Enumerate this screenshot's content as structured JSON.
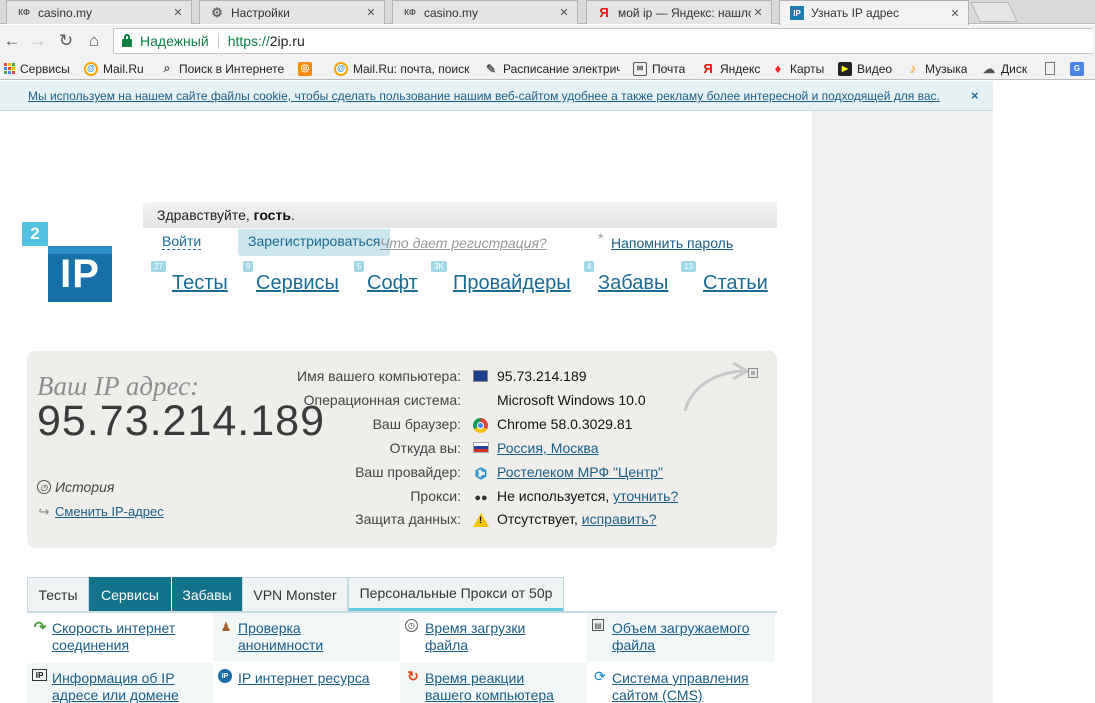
{
  "browser": {
    "tabs": [
      {
        "icon": "casino-favicon",
        "icon_text": "КФ",
        "title": "casino.my"
      },
      {
        "icon": "gear-icon",
        "icon_text": "⚙",
        "title": "Настройки"
      },
      {
        "icon": "casino-favicon",
        "icon_text": "КФ",
        "title": "casino.my"
      },
      {
        "icon": "yandex-icon",
        "icon_text": "Я",
        "title": "мой ip — Яндекс: нашлось"
      },
      {
        "icon": "2ip-favicon",
        "icon_text": "IP",
        "title": "Узнать IP адрес",
        "active": true
      }
    ],
    "tab_close": "✕",
    "address": {
      "secure_label": "Надежный",
      "scheme": "https://",
      "host": "2ip.ru"
    },
    "nav": {
      "back": "←",
      "forward": "→",
      "reload": "↻",
      "home": "⌂"
    },
    "bookmarks": [
      {
        "icon": "apps-icon",
        "label": "Сервисы"
      },
      {
        "icon": "mailru-icon",
        "icon_text": "@",
        "label": "Mail.Ru"
      },
      {
        "icon": "search-icon",
        "icon_text": "🔍",
        "label": "Поиск в Интернете"
      },
      {
        "icon": "odnoklassniki-icon",
        "icon_text": "ок",
        "label": ""
      },
      {
        "icon": "mailru-icon",
        "icon_text": "@",
        "label": "Mail.Ru: почта, поиск"
      },
      {
        "icon": "schedule-icon",
        "icon_text": "✎",
        "label": "Расписание электрич"
      },
      {
        "icon": "mail-envelope-icon",
        "icon_text": "✉",
        "label": "Почта"
      },
      {
        "icon": "yandex-icon",
        "icon_text": "Я",
        "label": "Яндекс"
      },
      {
        "icon": "maps-pin-icon",
        "icon_text": "♦",
        "label": "Карты"
      },
      {
        "icon": "video-icon",
        "icon_text": "▶",
        "label": "Видео"
      },
      {
        "icon": "music-icon",
        "icon_text": "♪",
        "label": "Музыка"
      },
      {
        "icon": "disk-icon",
        "icon_text": "☁",
        "label": "Диск"
      },
      {
        "icon": "document-icon",
        "icon_text": "",
        "label": ""
      },
      {
        "icon": "google-translate-icon",
        "icon_text": "G",
        "label": ""
      }
    ]
  },
  "cookie_bar": {
    "text": "Мы используем на нашем сайте файлы cookie, чтобы сделать пользование нашим веб-сайтом удобнее а также рекламу более интересной и подходящей для вас.",
    "close": "×"
  },
  "header": {
    "logo_badge": "2",
    "logo_text": "IP",
    "greeting_prefix": "Здравствуйте, ",
    "greeting_user": "гость",
    "greeting_suffix": ".",
    "login": "Войти",
    "register": "Зарегистрироваться",
    "why_register": "Что дает регистрация?",
    "remind_star": "*",
    "remind_password": "Напомнить пароль",
    "menu": [
      {
        "label": "Тесты",
        "badge": "27"
      },
      {
        "label": "Сервисы",
        "badge": "9"
      },
      {
        "label": "Софт",
        "badge": "5"
      },
      {
        "label": "Провайдеры",
        "badge": "3K"
      },
      {
        "label": "Забавы",
        "badge": "4"
      },
      {
        "label": "Статьи",
        "badge": "13"
      }
    ]
  },
  "ip_box": {
    "label": "Ваш IP адрес:",
    "ip": "95.73.214.189",
    "history": "История",
    "change_ip": "Сменить IP-адрес",
    "rows": [
      {
        "key": "Имя вашего компьютера:",
        "icon": "monitor-icon",
        "value": "95.73.214.189"
      },
      {
        "key": "Операционная система:",
        "icon": "windows-icon",
        "value": "Microsoft Windows 10.0"
      },
      {
        "key": "Ваш браузер:",
        "icon": "chrome-icon",
        "value": "Chrome 58.0.3029.81"
      },
      {
        "key": "Откуда вы:",
        "icon": "russia-flag-icon",
        "link": "Россия, Москва"
      },
      {
        "key": "Ваш провайдер:",
        "icon": "rostelecom-icon",
        "link": "Ростелеком МРФ \"Центр\""
      },
      {
        "key": "Прокси:",
        "icon": "glasses-icon",
        "value": "Не используется, ",
        "link": "уточнить?"
      },
      {
        "key": "Защита данных:",
        "icon": "warning-icon",
        "value": "Отсутствует, ",
        "link": "исправить?"
      }
    ]
  },
  "bottom_tabs": [
    {
      "label": "Тесты",
      "active": false
    },
    {
      "label": "Сервисы",
      "active": true
    },
    {
      "label": "Забавы",
      "active": true
    },
    {
      "label": "VPN Monster",
      "active": false
    },
    {
      "label": "Персональные Прокси от 50р",
      "active": false
    }
  ],
  "services": [
    {
      "icon": "speed-icon",
      "line1": "Скорость интернет",
      "line2": "соединения"
    },
    {
      "icon": "anonymity-icon",
      "line1": "Проверка",
      "line2": "анонимности"
    },
    {
      "icon": "clock-icon",
      "line1": "Время загрузки",
      "line2": "файла"
    },
    {
      "icon": "file-size-icon",
      "line1": "Объем загружаемого",
      "line2": "файла"
    },
    {
      "icon": "ip-info-icon",
      "line1": "Информация об IP",
      "line2": "адресе или домене"
    },
    {
      "icon": "ip-resource-icon",
      "line1": "IP интернет ресурса",
      "line2": ""
    },
    {
      "icon": "reaction-icon",
      "line1": "Время реакции",
      "line2": "вашего компьютера"
    },
    {
      "icon": "cms-icon",
      "line1": "Система управления",
      "line2": "сайтом (CMS)"
    }
  ],
  "colors": {
    "brand": "#1870a8",
    "accent": "#52c1e2",
    "link": "#1a5e86",
    "active_tab": "#13738a"
  }
}
